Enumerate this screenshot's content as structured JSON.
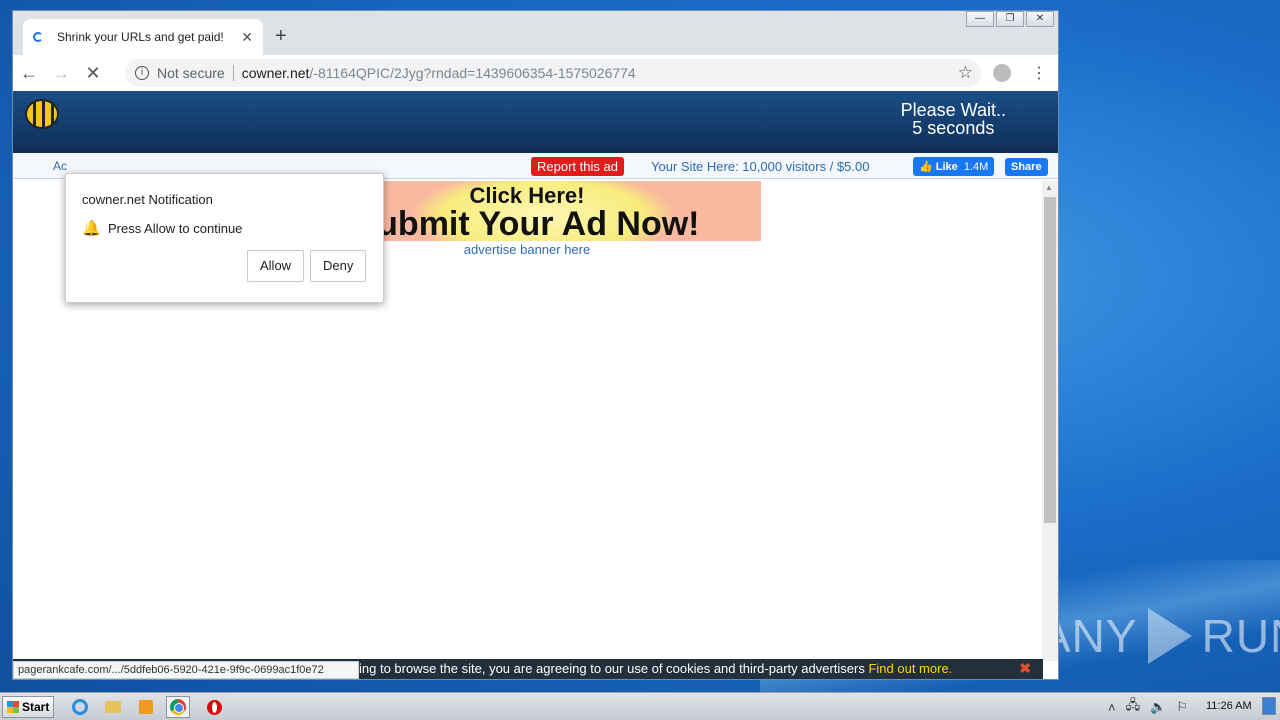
{
  "browser": {
    "tab_title": "Shrink your URLs and get paid!",
    "tab_close": "✕",
    "new_tab": "+",
    "back": "←",
    "forward": "→",
    "reload_stop": "✕",
    "security_label": "Not secure",
    "url_host": "cowner.net",
    "url_path": "/-81164QPIC/2Jyg?rndad=1439606354-1575026774",
    "bookmark_star": "☆",
    "menu": "⋮",
    "window_controls": [
      "—",
      "❐",
      "✕"
    ]
  },
  "notification": {
    "title": "cowner.net Notification",
    "message": "Press Allow to continue",
    "allow_label": "Allow",
    "deny_label": "Deny"
  },
  "page": {
    "wait_line1": "Please Wait..",
    "wait_line2": "5 seconds",
    "nav_partial": "Ac",
    "report_label": "Report this ad",
    "your_site": "Your Site Here: 10,000 visitors / $5.00",
    "fb_like": "Like",
    "fb_like_count": "1.4M",
    "fb_share": "Share",
    "banner_line1": "Click Here!",
    "banner_line2": "Submit Your Ad Now!",
    "banner_link": "advertise banner here",
    "cookie_text": "ing to browse the site, you are agreeing to our use of cookies and third-party advertisers",
    "cookie_link": "Find out more.",
    "cookie_close": "✖",
    "status_url": "pagerankcafe.com/.../5ddfeb06-5920-421e-9f9c-0699ac1f0e72"
  },
  "taskbar": {
    "start_label": "Start",
    "clock": "11:26 AM"
  },
  "watermark": {
    "left": "ANY",
    "right": "RUN"
  },
  "colors": {
    "header_bg": "#0f2e58",
    "report_bg": "#e21b1b",
    "facebook": "#1877f2",
    "link": "#2d6cb0",
    "cookie_link": "#ffd700"
  }
}
